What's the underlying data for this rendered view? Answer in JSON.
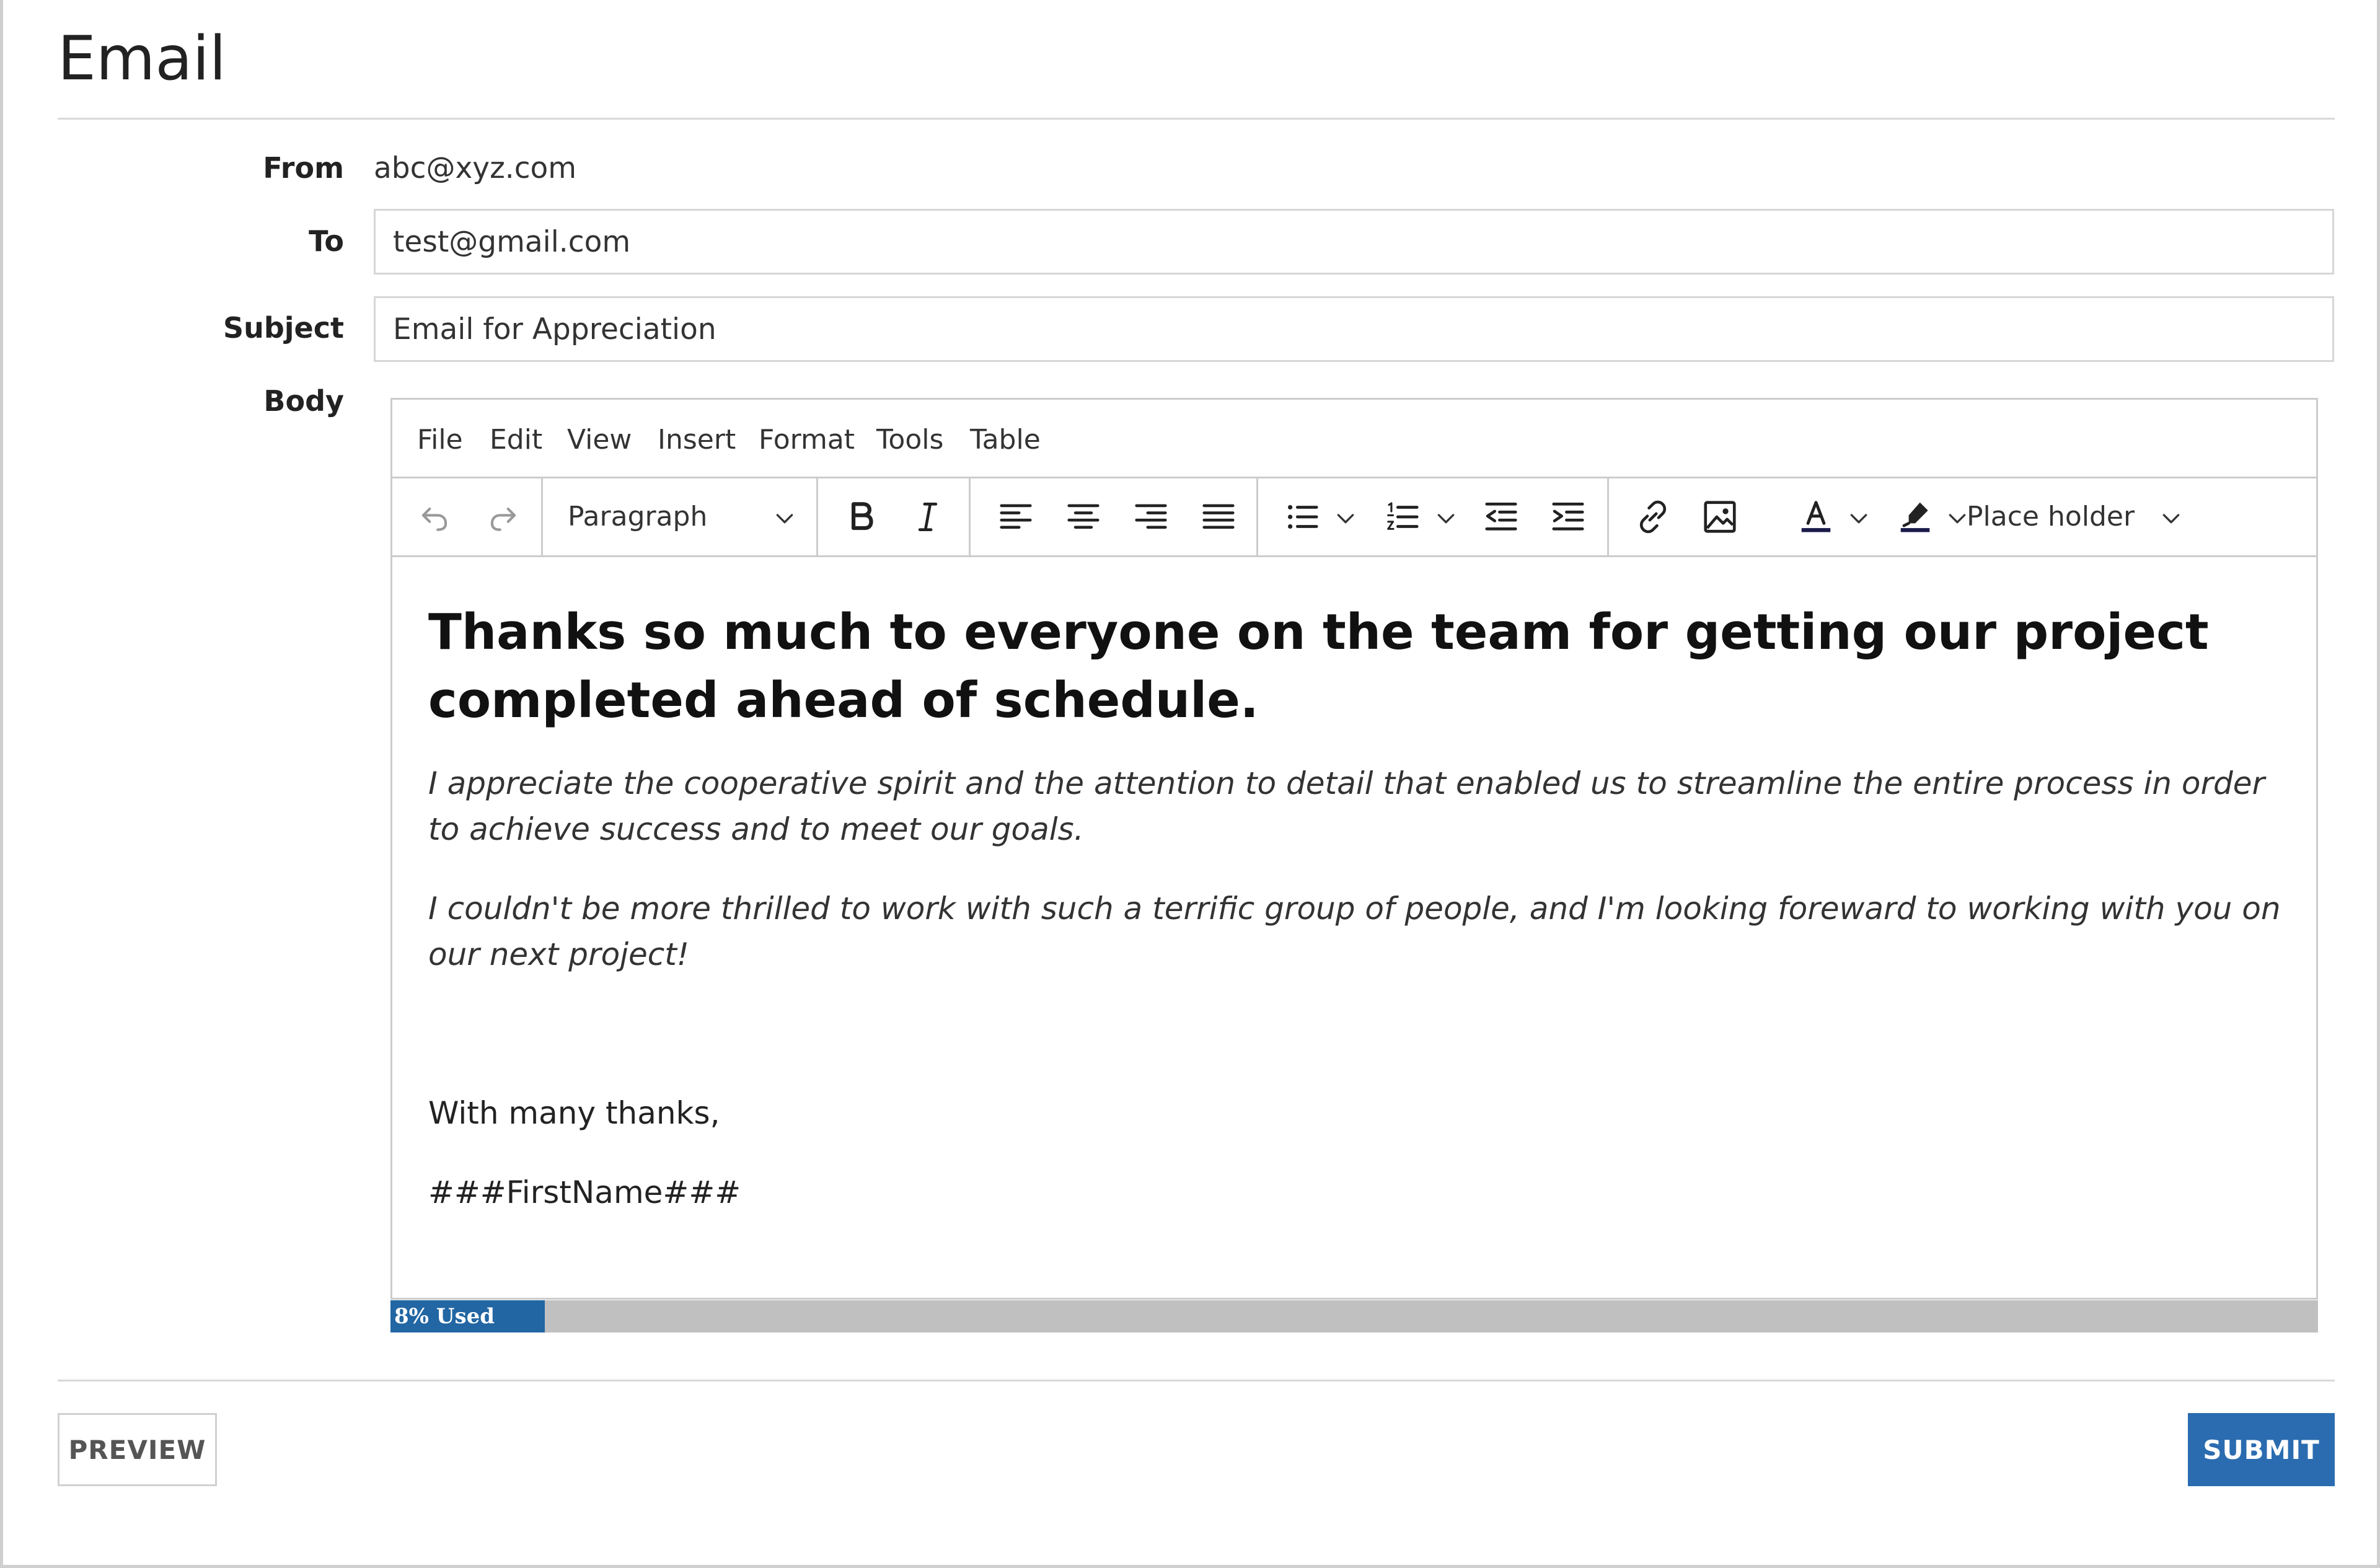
{
  "page": {
    "title": "Email"
  },
  "form": {
    "from_label": "From",
    "from_value": "abc@xyz.com",
    "to_label": "To",
    "to_value": "test@gmail.com",
    "subject_label": "Subject",
    "subject_value": "Email for Appreciation",
    "body_label": "Body"
  },
  "editor": {
    "menu": [
      "File",
      "Edit",
      "View",
      "Insert",
      "Format",
      "Tools",
      "Table"
    ],
    "toolbar": {
      "block_format": "Paragraph",
      "placeholder_menu": "Place holder",
      "icons": [
        "undo-icon",
        "redo-icon",
        "bold-icon",
        "italic-icon",
        "align-left-icon",
        "align-center-icon",
        "align-right-icon",
        "align-justify-icon",
        "bullet-list-icon",
        "numbered-list-icon",
        "outdent-icon",
        "indent-icon",
        "link-icon",
        "image-icon",
        "text-color-icon",
        "highlight-icon"
      ],
      "colors": {
        "text_color_bar": "#1a1a4a",
        "highlight_bar": "#1a1a4a"
      }
    },
    "content": {
      "heading": "Thanks so much to everyone on the team for getting our project completed ahead of schedule.",
      "para1": "I appreciate the cooperative spirit and the attention to detail that enabled us to streamline the entire process in order to achieve success and to meet our goals.",
      "para2": "I couldn't be more thrilled to work with such a terrific group of people, and I'm looking foreward to working with you on our next project!",
      "closing": "With many thanks,",
      "signature": "###FirstName###"
    },
    "usage": {
      "label": "8% Used",
      "fraction": 0.08,
      "fill_color": "#2266a3",
      "track_color": "#c0c0c0"
    }
  },
  "actions": {
    "preview_label": "PREVIEW",
    "submit_label": "SUBMIT",
    "submit_color": "#2b6cb0"
  }
}
